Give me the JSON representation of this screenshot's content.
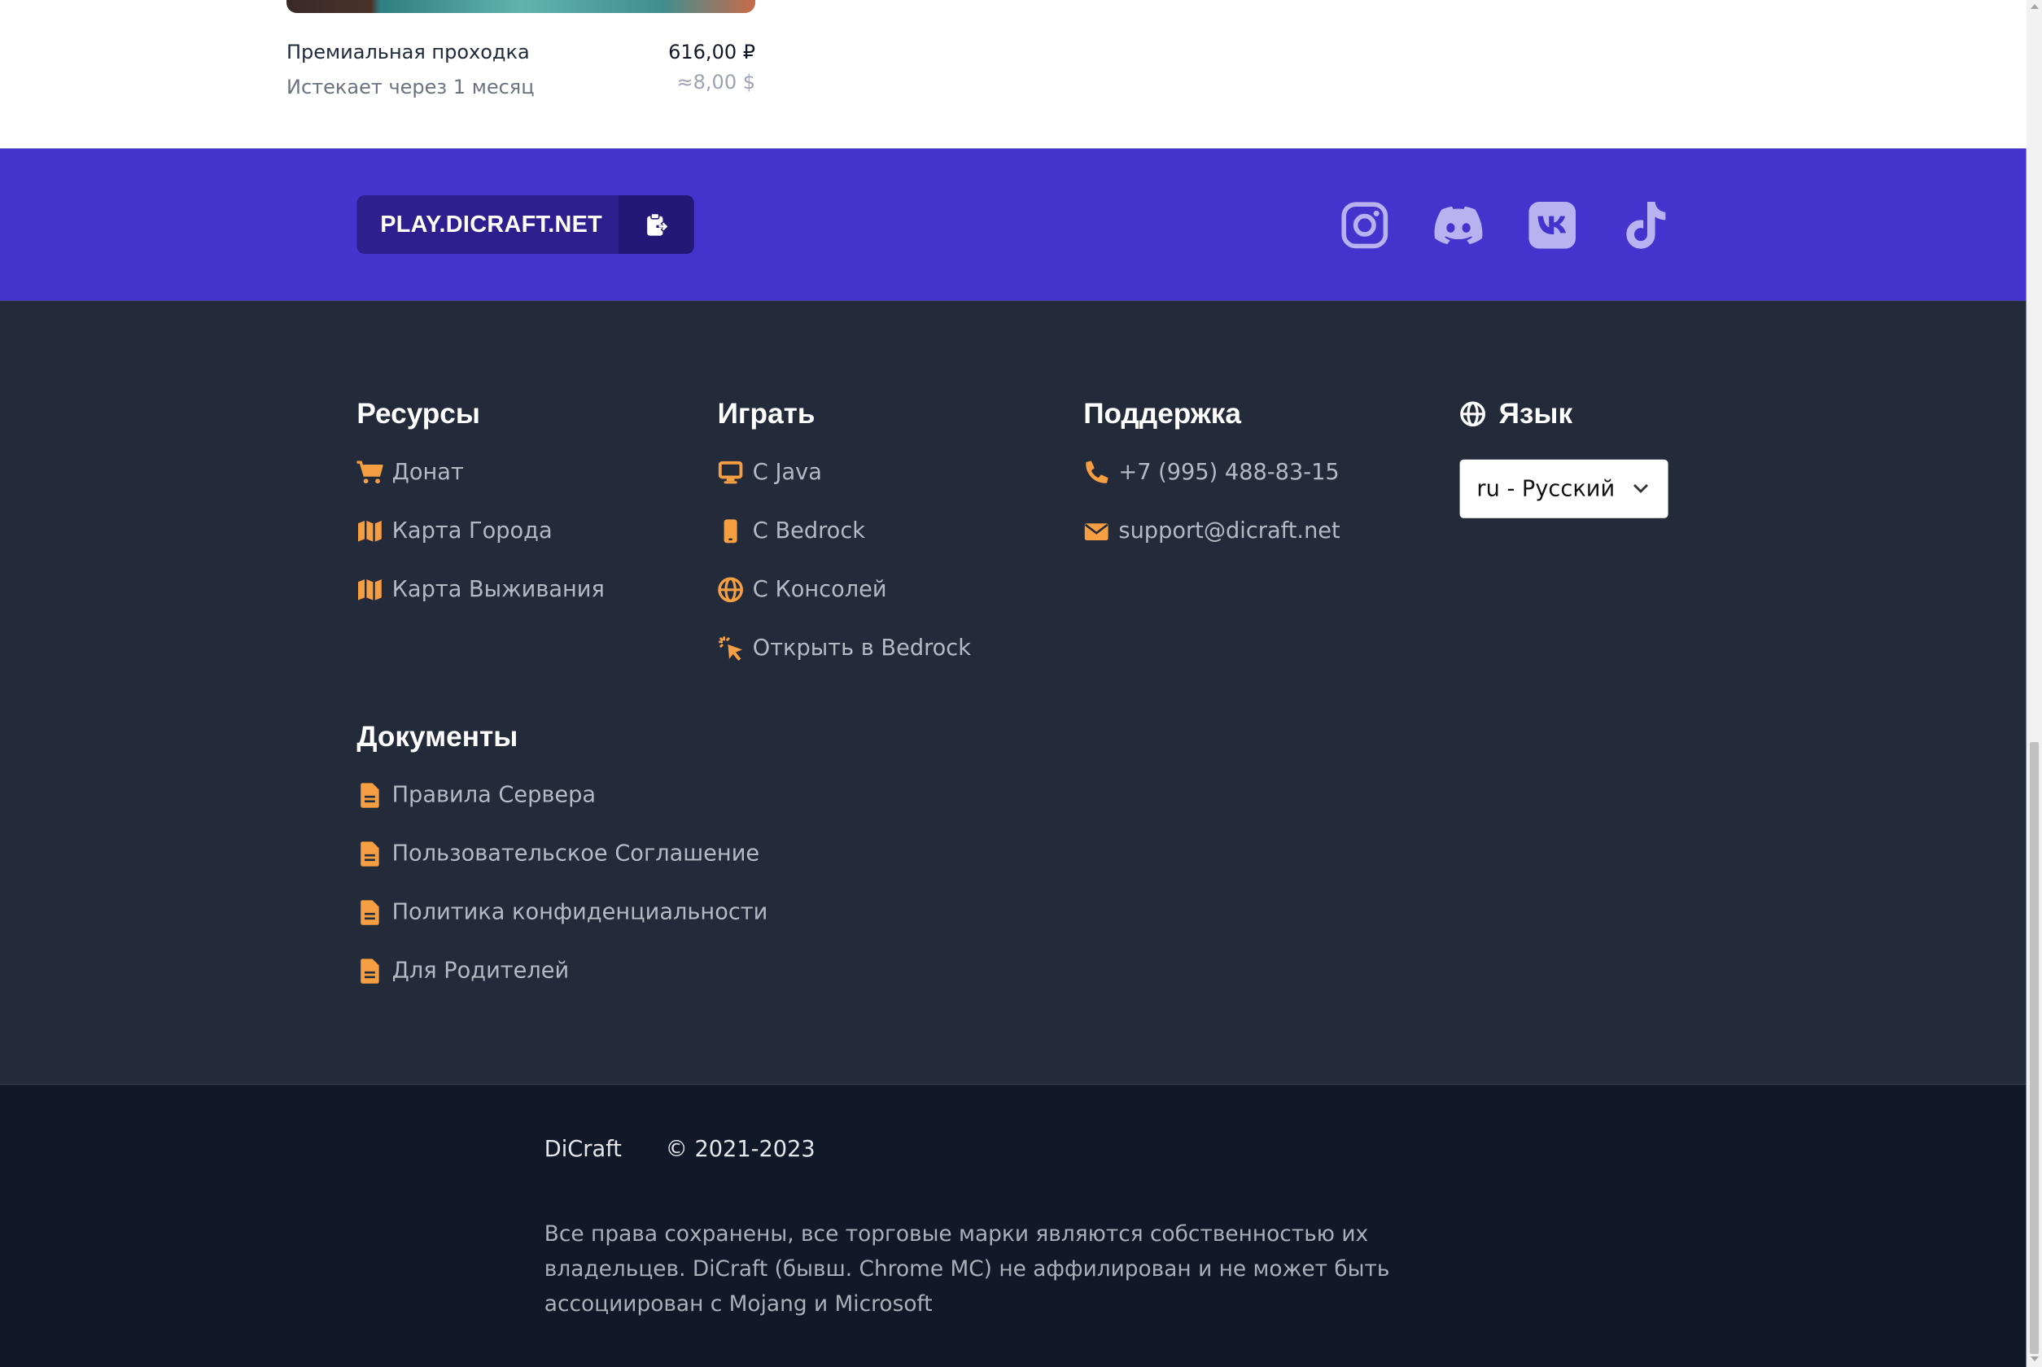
{
  "product": {
    "name": "Премиальная проходка",
    "price": "616,00 ₽",
    "expires": "Истекает через 1 месяц",
    "price_usd": "≈8,00 $"
  },
  "server_ip": {
    "address": "PLAY.DICRAFT.NET",
    "copy_icon": "clipboard-copy-icon"
  },
  "social": [
    {
      "name": "instagram-icon"
    },
    {
      "name": "discord-icon"
    },
    {
      "name": "vk-icon"
    },
    {
      "name": "tiktok-icon"
    }
  ],
  "columns": {
    "resources": {
      "title": "Ресурсы",
      "items": [
        {
          "label": "Донат",
          "icon": "cart-icon"
        },
        {
          "label": "Карта Города",
          "icon": "map-icon"
        },
        {
          "label": "Карта Выживания",
          "icon": "map-icon"
        }
      ]
    },
    "play": {
      "title": "Играть",
      "items": [
        {
          "label": "С Java",
          "icon": "desktop-icon"
        },
        {
          "label": "С Bedrock",
          "icon": "mobile-icon"
        },
        {
          "label": "С Консолей",
          "icon": "globe-icon"
        },
        {
          "label": "Открыть в Bedrock",
          "icon": "pointer-click-icon"
        }
      ]
    },
    "support": {
      "title": "Поддержка",
      "items": [
        {
          "label": "+7 (995) 488-83-15",
          "icon": "phone-icon"
        },
        {
          "label": "support@dicraft.net",
          "icon": "envelope-icon"
        }
      ]
    },
    "language": {
      "title": "Язык",
      "icon": "globe-icon",
      "selected": "ru - Русский"
    },
    "documents": {
      "title": "Документы",
      "items": [
        {
          "label": "Правила Сервера",
          "icon": "document-icon"
        },
        {
          "label": "Пользовательское Соглашение",
          "icon": "document-icon"
        },
        {
          "label": "Политика конфиденциальности",
          "icon": "document-icon"
        },
        {
          "label": "Для Родителей",
          "icon": "document-icon"
        }
      ]
    }
  },
  "bottom": {
    "brand": "DiCraft",
    "copyright": "© 2021-2023",
    "legal": "Все права сохранены, все торговые марки являются собственностью их владельцев. DiCraft (бывш. Chrome MC) не аффилирован и не может быть ассоциирован с Mojang и Microsoft"
  },
  "colors": {
    "accent": "#f59e42",
    "purple": "#4433cc",
    "footer_bg": "#232b3b",
    "bottom_bg": "#111827"
  }
}
